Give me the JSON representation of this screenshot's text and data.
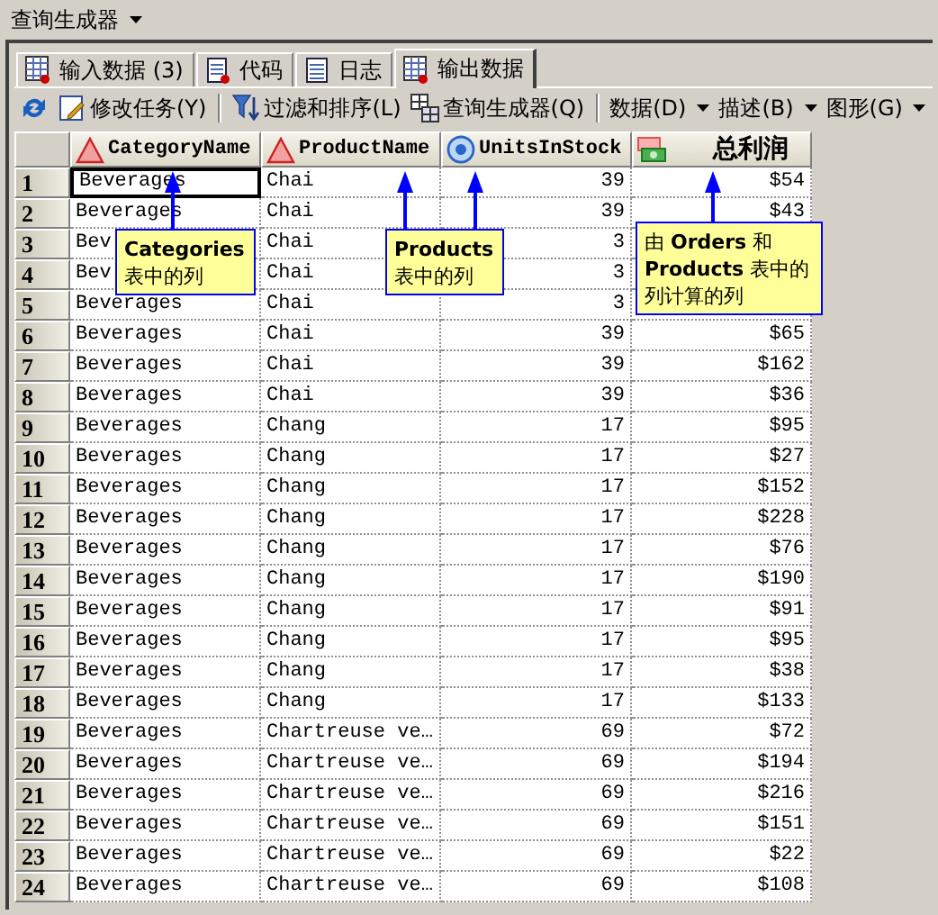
{
  "title": "查询生成器",
  "tabs": [
    {
      "label": "输入数据 (3)",
      "selected": false
    },
    {
      "label": "代码",
      "selected": false
    },
    {
      "label": "日志",
      "selected": false
    },
    {
      "label": "输出数据",
      "selected": true
    }
  ],
  "toolbar": [
    {
      "kind": "button"
    },
    {
      "kind": "button",
      "label": "修改任务(Y)"
    },
    {
      "kind": "separator"
    },
    {
      "kind": "button",
      "label": "过滤和排序(L)"
    },
    {
      "kind": "button",
      "label": "查询生成器(Q)"
    },
    {
      "kind": "separator"
    },
    {
      "kind": "menu",
      "label": "数据(D)"
    },
    {
      "kind": "menu",
      "label": "描述(B)"
    },
    {
      "kind": "menu",
      "label": "图形(G)"
    }
  ],
  "table": {
    "columns": [
      {
        "label": "CategoryName"
      },
      {
        "label": "ProductName"
      },
      {
        "label": "UnitsInStock"
      },
      {
        "label": "总利润"
      }
    ],
    "rows": [
      {
        "number": "1",
        "cursor": true,
        "cells": [
          "Beverages",
          "Chai",
          "39",
          "$54"
        ]
      },
      {
        "number": "2",
        "cursor": false,
        "cells": [
          "Beverages",
          "Chai",
          "39",
          "$43"
        ]
      },
      {
        "number": "3",
        "cursor": false,
        "cells": [
          "Bev",
          "Chai",
          "3",
          null
        ]
      },
      {
        "number": "4",
        "cursor": false,
        "cells": [
          "Bev",
          "Chai",
          "3",
          null
        ]
      },
      {
        "number": "5",
        "cursor": false,
        "cells": [
          "Beverages",
          "Chai",
          "3",
          null
        ]
      },
      {
        "number": "6",
        "cursor": false,
        "cells": [
          "Beverages",
          "Chai",
          "39",
          "$65"
        ]
      },
      {
        "number": "7",
        "cursor": false,
        "cells": [
          "Beverages",
          "Chai",
          "39",
          "$162"
        ]
      },
      {
        "number": "8",
        "cursor": false,
        "cells": [
          "Beverages",
          "Chai",
          "39",
          "$36"
        ]
      },
      {
        "number": "9",
        "cursor": false,
        "cells": [
          "Beverages",
          "Chang",
          "17",
          "$95"
        ]
      },
      {
        "number": "10",
        "cursor": false,
        "cells": [
          "Beverages",
          "Chang",
          "17",
          "$27"
        ]
      },
      {
        "number": "11",
        "cursor": false,
        "cells": [
          "Beverages",
          "Chang",
          "17",
          "$152"
        ]
      },
      {
        "number": "12",
        "cursor": false,
        "cells": [
          "Beverages",
          "Chang",
          "17",
          "$228"
        ]
      },
      {
        "number": "13",
        "cursor": false,
        "cells": [
          "Beverages",
          "Chang",
          "17",
          "$76"
        ]
      },
      {
        "number": "14",
        "cursor": false,
        "cells": [
          "Beverages",
          "Chang",
          "17",
          "$190"
        ]
      },
      {
        "number": "15",
        "cursor": false,
        "cells": [
          "Beverages",
          "Chang",
          "17",
          "$91"
        ]
      },
      {
        "number": "16",
        "cursor": false,
        "cells": [
          "Beverages",
          "Chang",
          "17",
          "$95"
        ]
      },
      {
        "number": "17",
        "cursor": false,
        "cells": [
          "Beverages",
          "Chang",
          "17",
          "$38"
        ]
      },
      {
        "number": "18",
        "cursor": false,
        "cells": [
          "Beverages",
          "Chang",
          "17",
          "$133"
        ]
      },
      {
        "number": "19",
        "cursor": false,
        "cells": [
          "Beverages",
          "Chartreuse ve…",
          "69",
          "$72"
        ]
      },
      {
        "number": "20",
        "cursor": false,
        "cells": [
          "Beverages",
          "Chartreuse ve…",
          "69",
          "$194"
        ]
      },
      {
        "number": "21",
        "cursor": false,
        "cells": [
          "Beverages",
          "Chartreuse ve…",
          "69",
          "$216"
        ]
      },
      {
        "number": "22",
        "cursor": false,
        "cells": [
          "Beverages",
          "Chartreuse ve…",
          "69",
          "$151"
        ]
      },
      {
        "number": "23",
        "cursor": false,
        "cells": [
          "Beverages",
          "Chartreuse ve…",
          "69",
          "$22"
        ]
      },
      {
        "number": "24",
        "cursor": false,
        "cells": [
          "Beverages",
          "Chartreuse ve…",
          "69",
          "$108"
        ]
      }
    ]
  },
  "callouts": [
    {
      "text": "**Categories**\n表中的列"
    },
    {
      "text": "**Products**\n表中的列"
    },
    {
      "text": "由 **Orders** 和\n**Products** 表中的列计算的列"
    }
  ]
}
